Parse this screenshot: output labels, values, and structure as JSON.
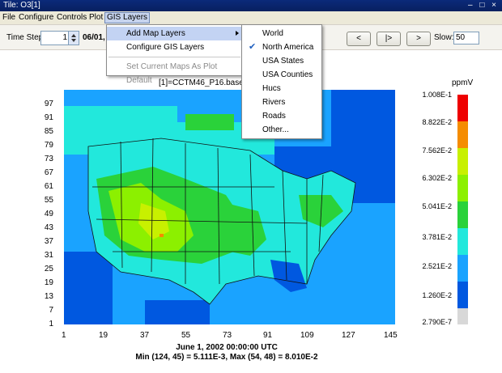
{
  "window": {
    "title": "Tile: O3[1]",
    "controls": "– □ ×"
  },
  "menubar": {
    "file": "File",
    "configure": "Configure",
    "controls": "Controls",
    "plot": "Plot",
    "gis": "GIS Layers"
  },
  "toolbar": {
    "time_step_label": "Time Step:",
    "time_step_value": "1",
    "date_fragment": "06/01,",
    "back_label": "<",
    "play_label": "|>",
    "forward_label": ">",
    "slow_label": "Slow:",
    "slow_value": "50"
  },
  "gis_menu": {
    "add_layers": "Add Map Layers",
    "configure": "Configure GIS Layers",
    "set_default": "Set Current Maps As Plot Default"
  },
  "layers_submenu": {
    "items": [
      "World",
      "North America",
      "USA States",
      "USA Counties",
      "Hucs",
      "Rivers",
      "Roads",
      "Other..."
    ],
    "checked": "North America"
  },
  "plot": {
    "title": "[1]=CCTM46_P16.base",
    "y_ticks": [
      "97",
      "91",
      "85",
      "79",
      "73",
      "67",
      "61",
      "55",
      "49",
      "43",
      "37",
      "31",
      "25",
      "19",
      "13",
      "7",
      "1"
    ],
    "x_ticks": [
      "1",
      "19",
      "37",
      "55",
      "73",
      "91",
      "109",
      "127",
      "145"
    ],
    "caption_line1": "June 1, 2002 00:00:00 UTC",
    "caption_line2": "Min (124, 45) = 5.111E-3, Max (54, 48) = 8.010E-2"
  },
  "legend": {
    "unit": "ppmV",
    "labels": [
      "1.008E-1",
      "8.822E-2",
      "7.562E-2",
      "6.302E-2",
      "5.041E-2",
      "3.781E-2",
      "2.521E-2",
      "1.260E-2",
      "2.790E-7"
    ],
    "colors": [
      "#ee0000",
      "#f58c00",
      "#c8f000",
      "#8cf000",
      "#2ad23a",
      "#22e8dc",
      "#1aa3ff",
      "#0058e0",
      "#d8d8d8"
    ]
  }
}
